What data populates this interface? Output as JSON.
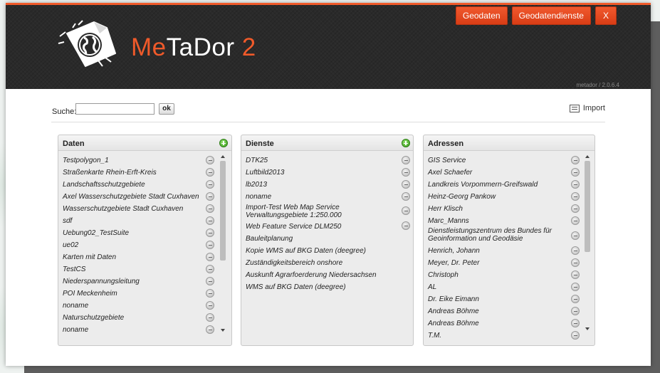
{
  "topnav": {
    "geodaten_label": "Geodaten",
    "geodatendienste_label": "Geodatendienste",
    "close_label": "X"
  },
  "brand": {
    "part1": "Me",
    "part2": "Ta",
    "part3": "Dor",
    "part4": " 2",
    "version": "metador / 2.0.6.4"
  },
  "search": {
    "label": "Suche:",
    "value": "",
    "ok_label": "ok"
  },
  "import_label": "Import",
  "panels": {
    "daten": {
      "title": "Daten",
      "items": [
        "Testpolygon_1",
        "Straßenkarte Rhein-Erft-Kreis",
        "Landschaftsschutzgebiete",
        "Axel Wasserschutzgebiete Stadt Cuxhaven",
        "Wasserschutzgebiete Stadt Cuxhaven",
        "sdf",
        "Uebung02_TestSuite",
        "ue02",
        "Karten mit Daten",
        "TestCS",
        "Niederspannungsleitung",
        "POI Meckenheim",
        "noname",
        "Naturschutzgebiete",
        "noname"
      ]
    },
    "dienste": {
      "title": "Dienste",
      "items": [
        "DTK25",
        "Luftbild2013",
        "lb2013",
        "noname",
        "Import-Test Web Map Service Verwaltungsgebiete 1:250.000",
        "Web Feature Service DLM250",
        "Bauleitplanung",
        "Kopie WMS auf BKG Daten (deegree)",
        "Zuständigkeitsbereich onshore",
        "Auskunft Agrarfoerderung Niedersachsen",
        "WMS auf BKG Daten (deegree)"
      ]
    },
    "adressen": {
      "title": "Adressen",
      "items": [
        "GIS Service",
        "Axel Schaefer",
        "Landkreis Vorpommern-Greifswald",
        "Heinz-Georg Pankow",
        "Herr Klisch",
        "Marc_Manns",
        "Dienstleistungszentrum des Bundes für Geoinformation und Geodäsie",
        "Henrich, Johann",
        "Meyer, Dr. Peter",
        "Christoph",
        "AL",
        "Dr. Eike Eimann",
        "Andreas Böhme",
        "Andreas Böhme",
        "T.M."
      ]
    }
  }
}
